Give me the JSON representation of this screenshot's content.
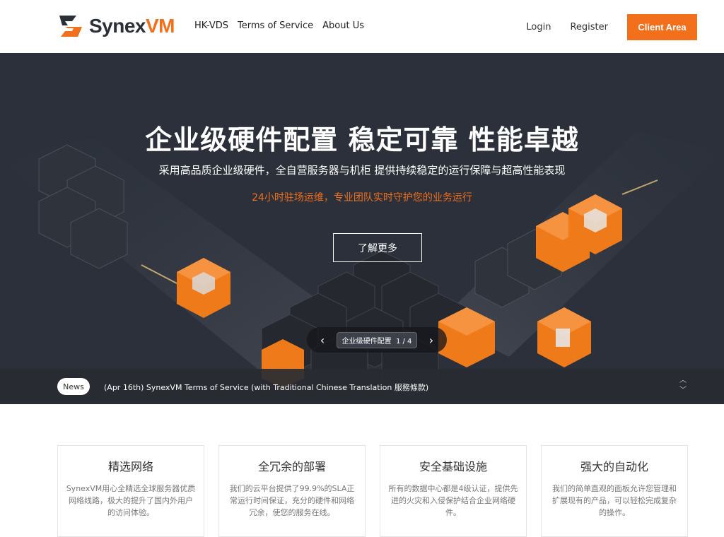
{
  "header": {
    "logo_text_a": "Synex",
    "logo_text_b": "VM",
    "nav": [
      "HK-VDS",
      "Terms of Service",
      "About Us"
    ],
    "login": "Login",
    "register": "Register",
    "client_area": "Client Area"
  },
  "hero": {
    "title": "企业级硬件配置 稳定可靠 性能卓越",
    "subtitle": "采用高品质企业级硬件，全自营服务器与机柜 提供持续稳定的运行保障与超高性能表现",
    "highlight": "24小时驻场运维，专业团队实时守护您的业务运行",
    "button": "了解更多",
    "slide_label": "企业级硬件配置",
    "slide_counter": "1 / 4"
  },
  "news": {
    "badge": "News",
    "text": "(Apr 16th) SynexVM Terms of Service (with Traditional Chinese Translation 服務條款)"
  },
  "features": [
    {
      "title": "精选网络",
      "desc": "SynexVM用心全精选全球服务器优质网络线路，极大的提升了国内外用户的访问体验。"
    },
    {
      "title": "全冗余的部署",
      "desc": "我们的云平台提供了99.9%的SLA正常运行时间保证，充分的硬件和网络冗余，使您的服务在线。"
    },
    {
      "title": "安全基础设施",
      "desc": "所有的数据中心都是4级认证，提供先进的火灾和入侵保护结合企业网络硬件。"
    },
    {
      "title": "强大的自动化",
      "desc": "我们的简单直观的面板允许您管理和扩展现有的产品，可以轻松完成复杂的操作。"
    }
  ],
  "colors": {
    "accent": "#f26f1b",
    "hero_bg": "#2b303a"
  }
}
